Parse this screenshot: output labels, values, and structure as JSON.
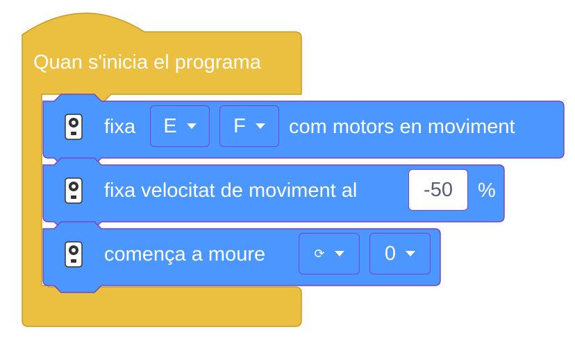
{
  "hat": {
    "label": "Quan s'inicia el programa"
  },
  "block1": {
    "prefix": "fixa",
    "port_a": "E",
    "port_b": "F",
    "suffix": "com motors en moviment"
  },
  "block2": {
    "prefix": "fixa velocitat de moviment al",
    "speed_value": "-50",
    "unit": "%"
  },
  "block3": {
    "prefix": "comença a moure",
    "direction_icon": "⟳",
    "steering_value": "0"
  },
  "colors": {
    "hat_fill": "#ebbf3f",
    "hat_stroke": "#c79a22",
    "motion_fill": "#4c97ff",
    "motion_stroke": "#7a44c0",
    "input_text": "#575e75"
  },
  "icons": [
    "hub-icon",
    "caret-down-icon",
    "rotation-icon"
  ]
}
